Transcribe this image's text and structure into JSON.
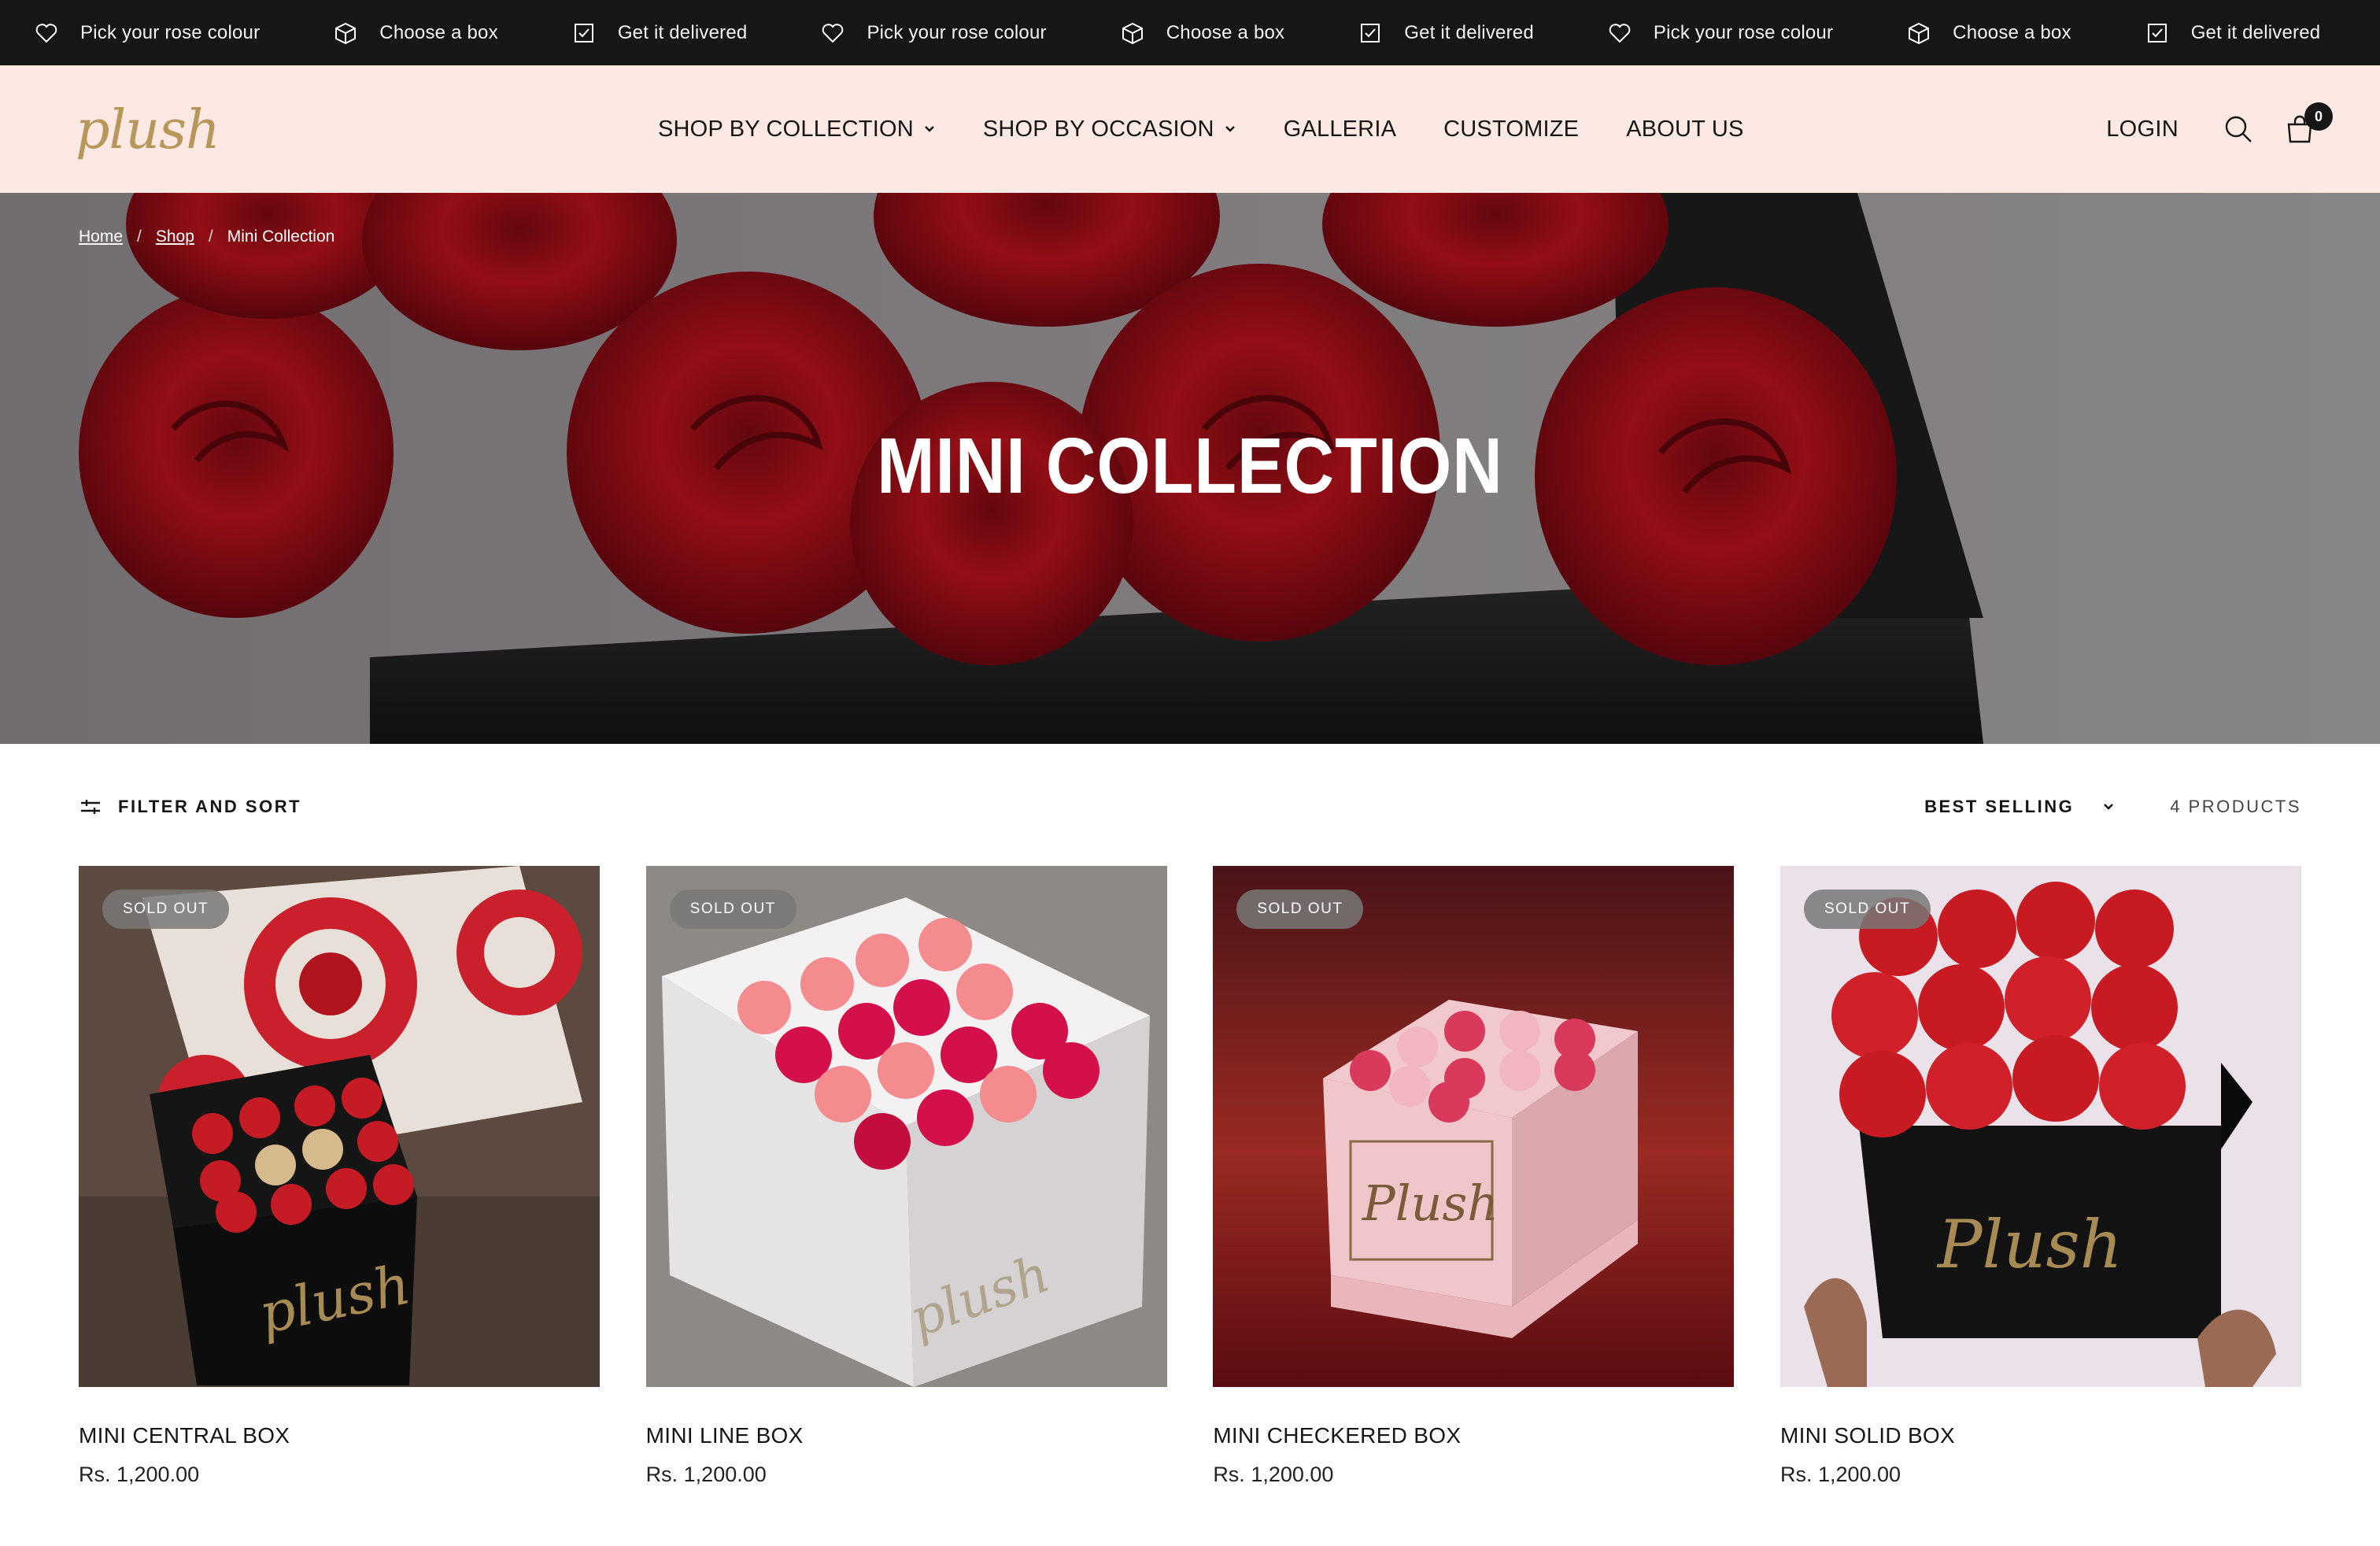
{
  "announcement": {
    "items": [
      {
        "icon": "heart-icon",
        "text": "Pick your rose colour"
      },
      {
        "icon": "box-icon",
        "text": "Choose a box"
      },
      {
        "icon": "checkbox-icon",
        "text": "Get it delivered"
      },
      {
        "icon": "heart-icon",
        "text": "Pick your rose colour"
      },
      {
        "icon": "box-icon",
        "text": "Choose a box"
      },
      {
        "icon": "checkbox-icon",
        "text": "Get it delivered"
      },
      {
        "icon": "heart-icon",
        "text": "Pick your rose colour"
      },
      {
        "icon": "box-icon",
        "text": "Choose a box"
      },
      {
        "icon": "checkbox-icon",
        "text": "Get it delivered"
      }
    ]
  },
  "header": {
    "logo": "plush",
    "nav": [
      {
        "label": "SHOP BY COLLECTION",
        "dropdown": true
      },
      {
        "label": "SHOP BY OCCASION",
        "dropdown": true
      },
      {
        "label": "GALLERIA",
        "dropdown": false
      },
      {
        "label": "CUSTOMIZE",
        "dropdown": false
      },
      {
        "label": "ABOUT US",
        "dropdown": false
      }
    ],
    "login": "LOGIN",
    "cart_count": "0"
  },
  "breadcrumb": {
    "home": "Home",
    "shop": "Shop",
    "current": "Mini Collection",
    "separator": "/"
  },
  "hero": {
    "title": "MINI COLLECTION"
  },
  "toolbar": {
    "filter_label": "FILTER AND SORT",
    "sort_label": "BEST SELLING",
    "count_label": "4 PRODUCTS"
  },
  "products": [
    {
      "name": "MINI CENTRAL BOX",
      "price": "Rs. 1,200.00",
      "badge": "SOLD OUT"
    },
    {
      "name": "MINI LINE BOX",
      "price": "Rs. 1,200.00",
      "badge": "SOLD OUT"
    },
    {
      "name": "MINI CHECKERED BOX",
      "price": "Rs. 1,200.00",
      "badge": "SOLD OUT"
    },
    {
      "name": "MINI SOLID BOX",
      "price": "Rs. 1,200.00",
      "badge": "SOLD OUT"
    }
  ],
  "colors": {
    "announcement_bg": "#161616",
    "header_bg": "#fde9e4",
    "logo_gold": "#b8975a",
    "rose_red": "#b5121b"
  }
}
